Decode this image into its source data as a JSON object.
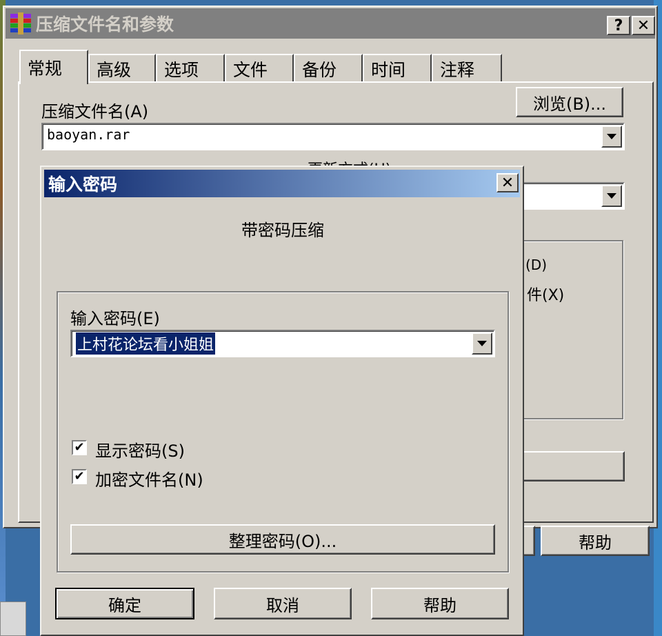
{
  "main_window": {
    "title": "压缩文件名和参数",
    "help_caption": "?",
    "close_caption": "✕",
    "tabs": [
      {
        "label": "常规"
      },
      {
        "label": "高级"
      },
      {
        "label": "选项"
      },
      {
        "label": "文件"
      },
      {
        "label": "备份"
      },
      {
        "label": "时间"
      },
      {
        "label": "注释"
      }
    ],
    "archive_name_label": "压缩文件名(A)",
    "browse_label": "浏览(B)...",
    "archive_name_value": "baoyan.rar",
    "update_mode_label_partial": "更新方式(U)",
    "option_fragment_1": "(D)",
    "option_fragment_2": "件(X)",
    "help_button_label": "帮助"
  },
  "password_dialog": {
    "title": "输入密码",
    "close_caption": "✕",
    "heading": "带密码压缩",
    "enter_password_label": "输入密码(E)",
    "password_value": "上村花论坛看小姐姐",
    "show_password_label": "显示密码(S)",
    "show_password_checked": true,
    "encrypt_filenames_label": "加密文件名(N)",
    "encrypt_filenames_checked": true,
    "organize_button_label": "整理密码(O)...",
    "ok_label": "确定",
    "cancel_label": "取消",
    "help_label": "帮助"
  }
}
